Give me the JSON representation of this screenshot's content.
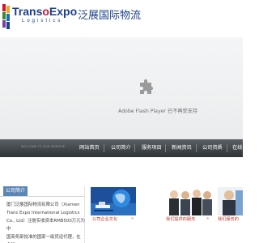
{
  "header": {
    "logo_text_pre": "Trans",
    "logo_text_o": "o",
    "logo_text_post": "Expo",
    "logo_sub": "Logistics",
    "logo_cn": "泛展国际物流"
  },
  "flash": {
    "icon": "puzzle-plugin-icon",
    "message": "Adobe Flash Player 已不再受支持"
  },
  "nav": {
    "welcome": "WELCOME TO OUR WEBSITE",
    "items": [
      {
        "label": "网站首页"
      },
      {
        "label": "公司简介"
      },
      {
        "label": "服务项目"
      },
      {
        "label": "新闻资讯"
      },
      {
        "label": "公司资质"
      },
      {
        "label": "在线咨"
      }
    ]
  },
  "about": {
    "title": "公司简介",
    "text_lines": [
      "厦门泛展国际物流有限公司（Xiamen",
      "Trans Expo International Logistics",
      "Co., Ltd）注册实收资本RMB500万元为中",
      "国商务部批准的国家一级货运代理，在全球"
    ]
  },
  "services": [
    {
      "caption": "公司企业文化",
      "more": "»"
    },
    {
      "caption": "我们提供的服务",
      "more": "»"
    },
    {
      "caption": "我们服务的"
    }
  ],
  "colors": {
    "brand_blue": "#1b3f8b",
    "brand_red": "#d4122a",
    "nav_dark": "#2e3336",
    "panel_blue": "#5b87b6",
    "caption_red": "#c0392b"
  }
}
